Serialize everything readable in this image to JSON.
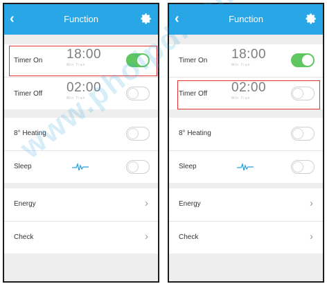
{
  "screens": [
    {
      "title": "Function",
      "timer_on": {
        "label": "Timer On",
        "time": "18:00",
        "sub": "Min Tran",
        "enabled": true
      },
      "timer_off": {
        "label": "Timer Off",
        "time": "02:00",
        "sub": "Min Tran",
        "enabled": false
      },
      "heating": {
        "label": "8° Heating",
        "enabled": false
      },
      "sleep": {
        "label": "Sleep",
        "enabled": false
      },
      "energy": {
        "label": "Energy"
      },
      "check": {
        "label": "Check"
      }
    },
    {
      "title": "Function",
      "timer_on": {
        "label": "Timer On",
        "time": "18:00",
        "sub": "Min Tran",
        "enabled": true
      },
      "timer_off": {
        "label": "Timer Off",
        "time": "02:00",
        "sub": "Min Tran",
        "enabled": false
      },
      "heating": {
        "label": "8° Heating",
        "enabled": false
      },
      "sleep": {
        "label": "Sleep",
        "enabled": false
      },
      "energy": {
        "label": "Energy"
      },
      "check": {
        "label": "Check"
      }
    }
  ],
  "icons": {
    "back": "back-chevron-icon",
    "settings": "gear-icon",
    "sleep": "sleep-wave-icon",
    "arrow": "chevron-right-icon"
  },
  "colors": {
    "header": "#28a6e6",
    "toggle_on": "#5fc75f",
    "highlight": "#e53030",
    "watermark": "#29a3e0"
  },
  "watermark": "www.pholpd.com",
  "highlights": [
    "screens.0.timer_on",
    "screens.1.timer_off"
  ]
}
